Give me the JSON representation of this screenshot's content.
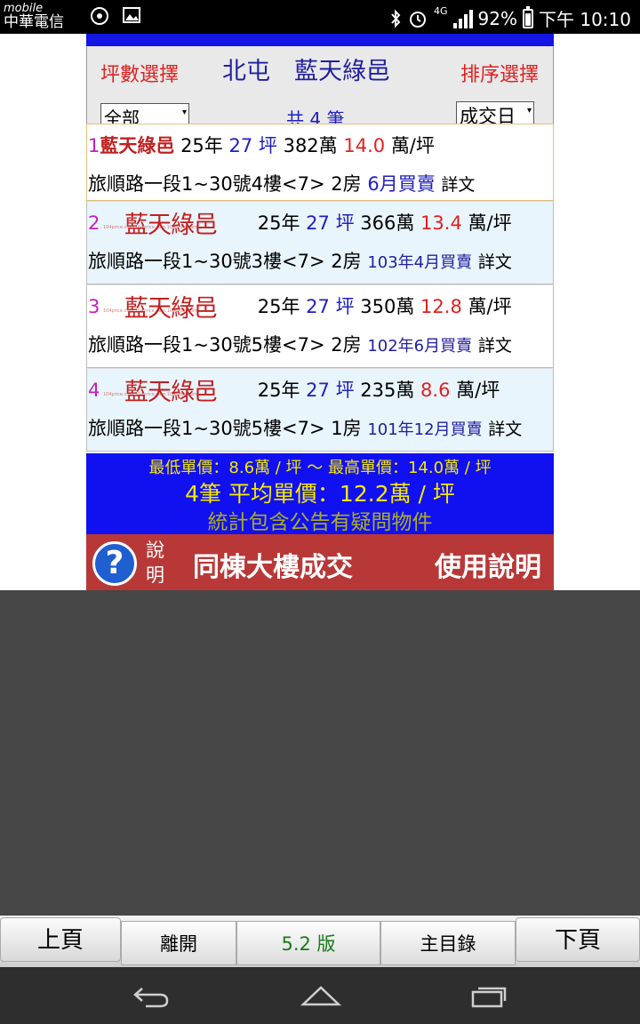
{
  "status": {
    "carrier_top": "mobile",
    "carrier_bottom": "中華電信",
    "network": "4G",
    "battery": "92%",
    "time": "下午 10:10"
  },
  "header": {
    "left_label": "坪數選擇",
    "title": "北屯　藍天綠邑",
    "right_label": "排序選擇",
    "size_select": "全部",
    "sort_select": "成交日",
    "count": "共 4 筆"
  },
  "watermark": {
    "name": "藍天綠邑",
    "site": "104price.com.104price.com.104price.com"
  },
  "records": [
    {
      "num": "1",
      "name": "藍天綠邑",
      "age": "25年",
      "area": "27 坪",
      "price": "382萬",
      "unit_price": "14.0",
      "unit": "萬/坪",
      "address": "旅順路一段1~30號4樓<7> 2房",
      "deal": "6月買賣",
      "detail": "詳文"
    },
    {
      "num": "2",
      "name": "",
      "age": "25年",
      "area": "27 坪",
      "price": "366萬",
      "unit_price": "13.4",
      "unit": "萬/坪",
      "address": "旅順路一段1~30號3樓<7> 2房",
      "deal": "103年4月買賣",
      "detail": "詳文"
    },
    {
      "num": "3",
      "name": "",
      "age": "25年",
      "area": "27 坪",
      "price": "350萬",
      "unit_price": "12.8",
      "unit": "萬/坪",
      "address": "旅順路一段1~30號5樓<7> 2房",
      "deal": "102年6月買賣",
      "detail": "詳文"
    },
    {
      "num": "4",
      "name": "",
      "age": "25年",
      "area": "27 坪",
      "price": "235萬",
      "unit_price": "8.6",
      "unit": "萬/坪",
      "address": "旅順路一段1~30號5樓<7> 1房",
      "deal": "101年12月買賣",
      "detail": "詳文"
    }
  ],
  "stats": {
    "min_max": "最低單價：8.6萬 / 坪 ～ 最高單價：14.0萬 / 坪",
    "average": "4筆 平均單價：12.2萬 / 坪",
    "note": "統計包含公告有疑問物件"
  },
  "help": {
    "q_label": "說明",
    "title": "同棟大樓成交",
    "link": "使用說明"
  },
  "toolbar": {
    "prev": "上頁",
    "leave": "離開",
    "version": "5.2 版",
    "home": "主目錄",
    "next": "下頁"
  },
  "colors": {
    "primary_blue": "#1010f0",
    "yellow": "#f5e900",
    "red": "#e02020",
    "help_bg": "#b83838"
  }
}
